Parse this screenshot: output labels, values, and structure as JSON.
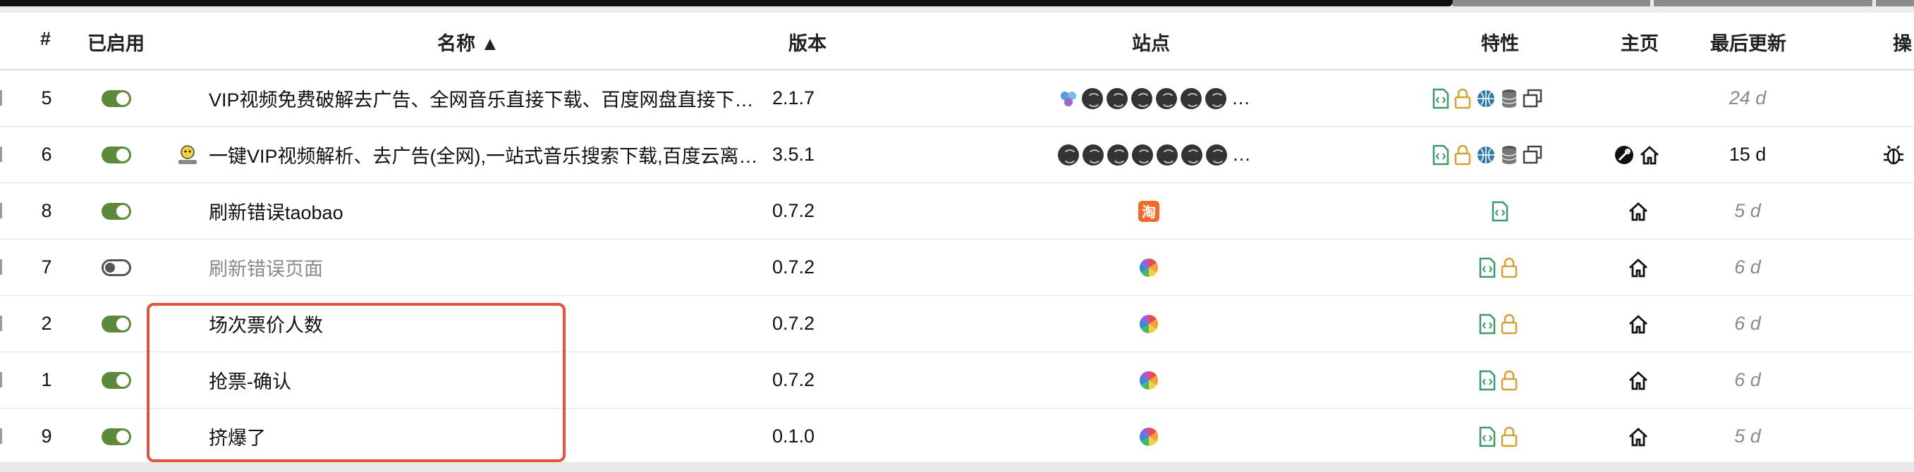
{
  "header": {
    "num": "#",
    "enabled": "已启用",
    "name": "名称 ▲",
    "version": "版本",
    "sites": "站点",
    "features": "特性",
    "homepage": "主页",
    "updated": "最后更新",
    "actions": "操"
  },
  "rows": [
    {
      "num": "5",
      "enabled": true,
      "name": "VIP视频免费破解去广告、全网音乐直接下载、百度网盘直接下…",
      "version": "2.1.7",
      "site_overflow": "…",
      "updated": "24 d"
    },
    {
      "num": "6",
      "enabled": true,
      "name": "一键VIP视频解析、去广告(全网),一站式音乐搜索下载,百度云离…",
      "version": "3.5.1",
      "site_overflow": "…",
      "updated": "15 d"
    },
    {
      "num": "8",
      "enabled": true,
      "name": "刷新错误taobao",
      "version": "0.7.2",
      "updated": "5 d"
    },
    {
      "num": "7",
      "enabled": false,
      "name": "刷新错误页面",
      "version": "0.7.2",
      "updated": "6 d"
    },
    {
      "num": "2",
      "enabled": true,
      "name": "场次票价人数",
      "version": "0.7.2",
      "updated": "6 d"
    },
    {
      "num": "1",
      "enabled": true,
      "name": "抢票-确认",
      "version": "0.7.2",
      "updated": "6 d"
    },
    {
      "num": "9",
      "enabled": true,
      "name": "挤爆了",
      "version": "0.1.0",
      "updated": "5 d"
    }
  ],
  "colors": {
    "toggle_on": "#5a8a3a",
    "script_icon": "#3a9a6a",
    "lock_icon": "#d4a030",
    "globe_icon": "#2a7ab0",
    "highlight_box": "#e4533a",
    "taobao": "#f06a2a"
  },
  "icons": [
    "toggle-switch",
    "script-file-icon",
    "lock-icon",
    "globe-icon",
    "database-icon",
    "window-icon",
    "home-icon",
    "bug-icon",
    "gear-icon",
    "site-globe-icon",
    "taobao-icon",
    "rainbow-site-icon",
    "user-logo-icon"
  ]
}
